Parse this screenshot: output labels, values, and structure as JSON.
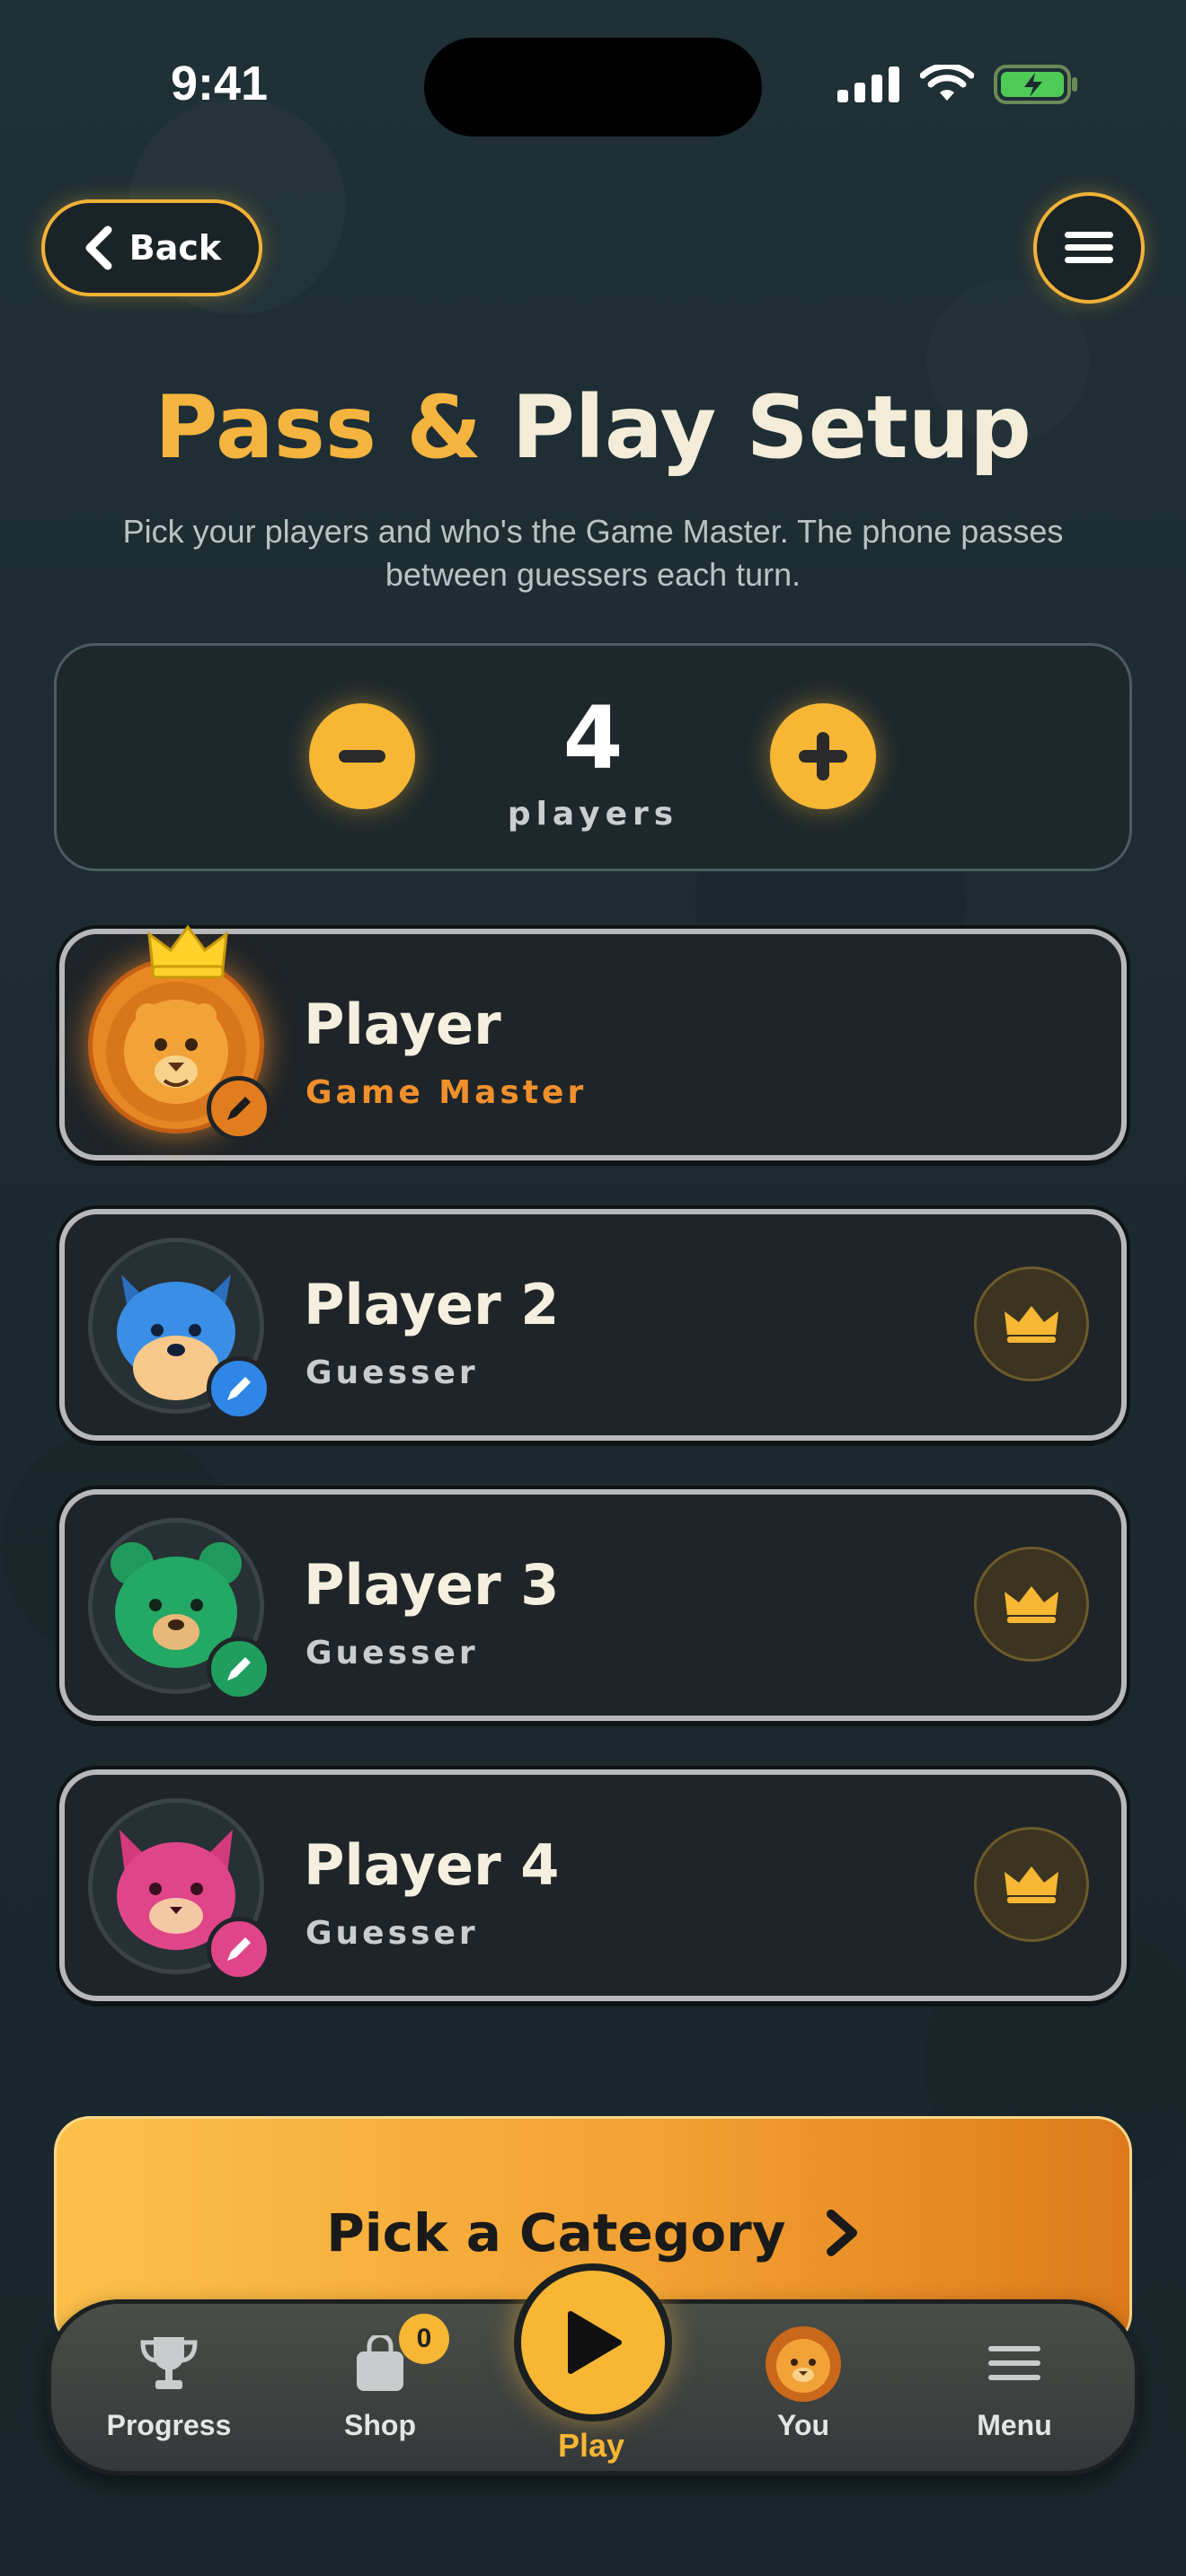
{
  "status_bar": {
    "time": "9:41"
  },
  "header": {
    "back_label": "Back",
    "title_part1": "Pass & ",
    "title_part2": "Play Setup",
    "subtitle": "Pick your players and who's the Game Master. The phone passes between guessers each turn."
  },
  "counter": {
    "count": "4",
    "label": "players"
  },
  "players": [
    {
      "name": "Player",
      "role": "Game Master",
      "avatar": "lion",
      "badge_color": "#e27d1f"
    },
    {
      "name": "Player 2",
      "role": "Guesser",
      "avatar": "blue-fox",
      "badge_color": "#2f86e6"
    },
    {
      "name": "Player 3",
      "role": "Guesser",
      "avatar": "green-bear",
      "badge_color": "#1f9e5e"
    },
    {
      "name": "Player 4",
      "role": "Guesser",
      "avatar": "pink-cat",
      "badge_color": "#e0458a"
    }
  ],
  "cta": {
    "label": "Pick a Category"
  },
  "tabbar": {
    "tabs": [
      {
        "label": "Progress",
        "icon": "trophy-icon"
      },
      {
        "label": "Shop",
        "icon": "shopping-bag-icon",
        "badge": "0"
      },
      {
        "label": "Play",
        "icon": "play-icon",
        "active": true
      },
      {
        "label": "You",
        "icon": "lion-avatar-icon"
      },
      {
        "label": "Menu",
        "icon": "hamburger-icon"
      }
    ]
  },
  "colors": {
    "accent": "#f7b633",
    "background": "#1c2a2f",
    "game_master": "#f0902c"
  }
}
